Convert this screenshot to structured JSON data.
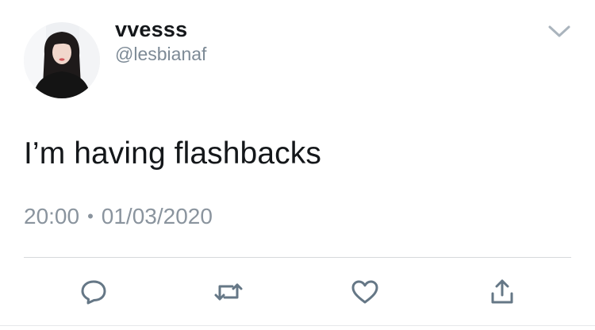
{
  "user": {
    "display_name": "vvesss",
    "handle": "@lesbianaf",
    "avatar_icon": "profile-photo"
  },
  "tweet": {
    "text": "I’m having flashbacks",
    "time": "20:00",
    "separator": "•",
    "date": "01/03/2020"
  },
  "actions": [
    {
      "name": "reply",
      "icon": "reply-bubble-icon"
    },
    {
      "name": "retweet",
      "icon": "retweet-arrows-icon"
    },
    {
      "name": "like",
      "icon": "heart-icon"
    },
    {
      "name": "share",
      "icon": "share-upload-icon"
    }
  ],
  "colors": {
    "text_primary": "#14171a",
    "text_secondary": "#7d8a96",
    "icon": "#657786",
    "divider": "#d6d9dc"
  }
}
